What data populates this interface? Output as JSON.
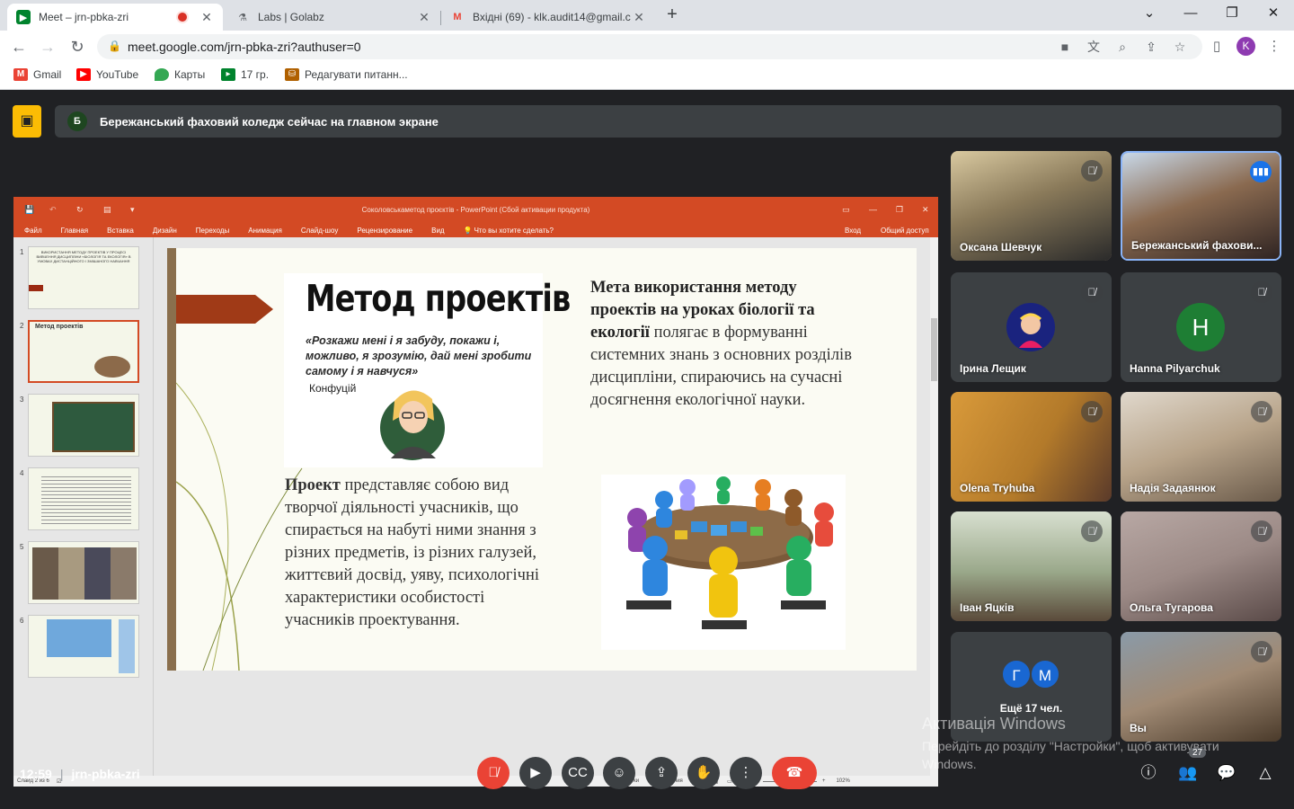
{
  "browser": {
    "tabs": [
      {
        "title": "Meet – jrn-pbka-zri",
        "favicon": "meet-icon",
        "recording": true
      },
      {
        "title": "Labs | Golabz",
        "favicon": "flask-icon"
      },
      {
        "title": "Вхідні (69) - klk.audit14@gmail.c",
        "favicon": "gmail-icon"
      }
    ],
    "url": "meet.google.com/jrn-pbka-zri?authuser=0",
    "profile_initial": "K",
    "bookmarks": [
      {
        "label": "Gmail",
        "icon": "gmail-icon",
        "color": "#ea4335"
      },
      {
        "label": "YouTube",
        "icon": "youtube-icon",
        "color": "#ff0000"
      },
      {
        "label": "Карты",
        "icon": "maps-pin-icon",
        "color": "#34a853"
      },
      {
        "label": "17 гр.",
        "icon": "meet-icon",
        "color": "#00832d"
      },
      {
        "label": "Редагувати питанн...",
        "icon": "forms-icon",
        "color": "#b06000"
      }
    ]
  },
  "meet": {
    "presenting_banner": "Бережанський фаховий коледж сейчас на главном экране",
    "presenter_initial": "Б",
    "meeting_code": "jrn-pbka-zri",
    "time": "12:59",
    "participants_count": "27",
    "participants": [
      {
        "name": "Оксана Шевчук",
        "video": true,
        "bg": "#b79a76"
      },
      {
        "name": "Бережанський фахови...",
        "video": true,
        "bg": "#a68f74",
        "speaking": true
      },
      {
        "name": "Ірина Лещик",
        "avatar_bg": "#1a237e",
        "avatar_letter": ""
      },
      {
        "name": "Hanna Pilyarchuk",
        "avatar_bg": "#1e7e34",
        "avatar_letter": "H"
      },
      {
        "name": "Olena Tryhuba",
        "video": true,
        "bg": "#c78a3b"
      },
      {
        "name": "Надія Задаянюк",
        "video": true,
        "bg": "#c9b9a6"
      },
      {
        "name": "Іван Яцків",
        "video": true,
        "bg": "#8f9f87"
      },
      {
        "name": "Ольга Тугарова",
        "video": true,
        "bg": "#9c8a86"
      },
      {
        "name": "Вы",
        "video": true,
        "bg": "#8a7a6c"
      }
    ],
    "more": {
      "label": "Ещё 17 чел.",
      "initials": [
        "Г",
        "М"
      ]
    }
  },
  "ppt": {
    "window_title": "Соколовськаметод проєктів - PowerPoint (Сбой активации продукта)",
    "menu": [
      "Файл",
      "Главная",
      "Вставка",
      "Дизайн",
      "Переходы",
      "Анимация",
      "Слайд-шоу",
      "Рецензирование",
      "Вид"
    ],
    "search_hint": "Что вы хотите сделать?",
    "login": "Вход",
    "share": "Общий доступ",
    "status_left": "Слайд 2 из 6",
    "status_notes": "Заметки",
    "status_comments": "Примечания",
    "zoom": "102%",
    "thumbnails": [
      {
        "num": "1",
        "text": "ВИКОРИСТАННЯ МЕТОДУ ПРОЕКТІВ У ПРОЦЕСІ ВИВЧЕННЯ ДИСЦИПЛІНИ «БІОЛОГІЯ ТА ЕКОЛОГІЯ» В УМОВАХ ДИСТАНЦІЙНОГО І ЗМІШАНОГО НАВЧАННЯ"
      },
      {
        "num": "2",
        "text": "Метод проектів"
      },
      {
        "num": "3",
        "text": ""
      },
      {
        "num": "4",
        "text": ""
      },
      {
        "num": "5",
        "text": ""
      },
      {
        "num": "6",
        "text": ""
      }
    ],
    "slide": {
      "title": "Метод проектів",
      "quote": "«Розкажи мені і я забуду, покажи і, можливо, я зрозумію, дай мені зробити самому і я навчуся»",
      "author": "Конфуцій",
      "goal_bold": "Мета використання методу проектів на уроках біології та екології",
      "goal_rest": " полягає в формуванні системних знань з основних розділів дисципліни, спираючись на сучасні досягнення екологічної науки.",
      "project_bold": "Проект",
      "project_rest": " представляє собою вид творчої діяльності учасників, що спирається на набуті ними знання з різних предметів, із різних галузей, життєвий досвід, уяву, психологічні характеристики особистості учасників проектування."
    }
  },
  "windows_activation": {
    "title": "Активація Windows",
    "text": "Перейдіть до розділу \"Настройки\", щоб активувати Windows."
  }
}
